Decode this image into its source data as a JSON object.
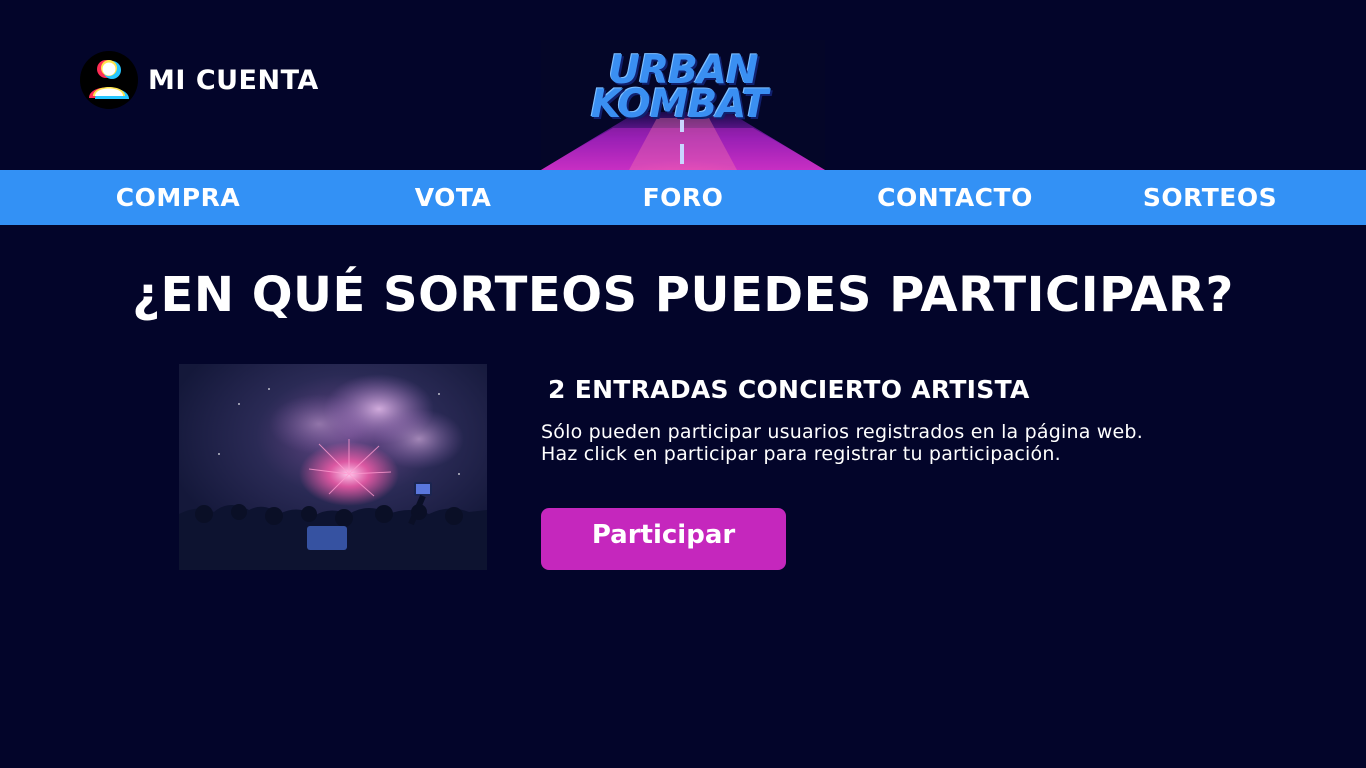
{
  "header": {
    "account_label": "MI CUENTA",
    "logo": {
      "line1": "URBAN",
      "line2": "KOMBAT"
    }
  },
  "nav": {
    "items": [
      {
        "label": "COMPRA"
      },
      {
        "label": "VOTA"
      },
      {
        "label": "FORO"
      },
      {
        "label": "CONTACTO"
      },
      {
        "label": "SORTEOS"
      }
    ]
  },
  "main": {
    "title": "¿EN QUÉ SORTEOS PUEDES PARTICIPAR?",
    "prize": {
      "title": "2 ENTRADAS CONCIERTO ARTISTA",
      "description": "Sólo pueden participar usuarios registrados en la página web. Haz click en participar para registrar tu participación.",
      "button_label": "Participar",
      "image": "concert-fireworks-photo"
    }
  },
  "colors": {
    "background": "#03052a",
    "nav": "#3391f5",
    "button": "#c527bd",
    "logo_text": "#3a8ff2"
  }
}
